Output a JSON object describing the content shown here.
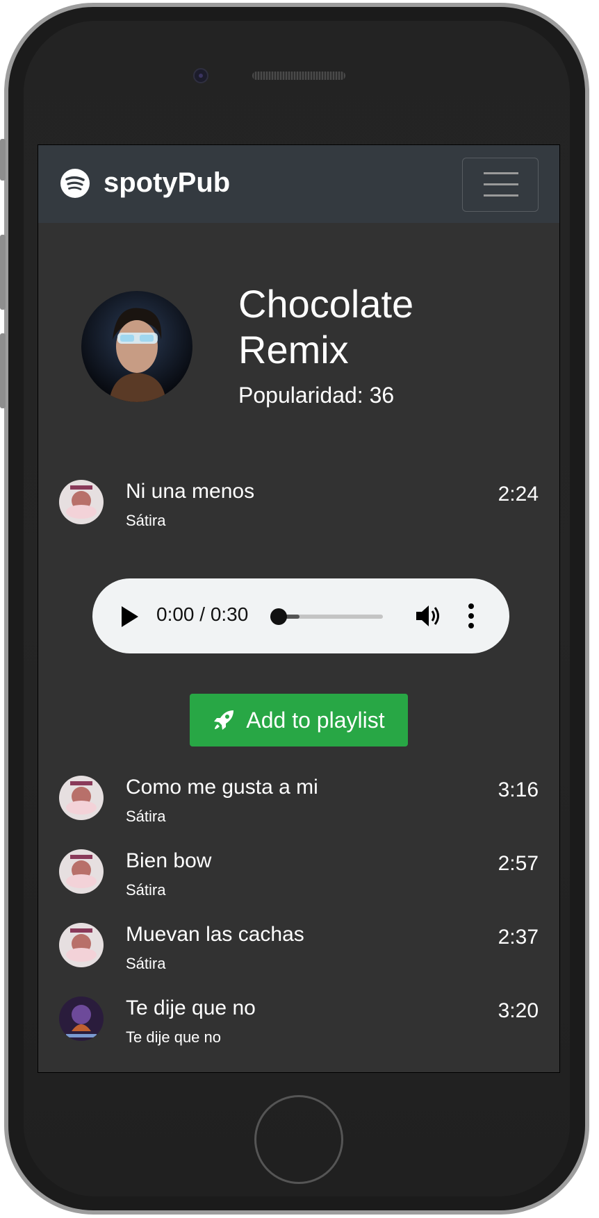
{
  "app": {
    "brand": "spotyPub"
  },
  "artist": {
    "name": "Chocolate Remix",
    "popularity_text": "Popularidad: 36"
  },
  "tracks": [
    {
      "title": "Ni una menos",
      "artist": "Sátira",
      "duration": "2:24"
    },
    {
      "title": "Como me gusta a mi",
      "artist": "Sátira",
      "duration": "3:16"
    },
    {
      "title": "Bien bow",
      "artist": "Sátira",
      "duration": "2:57"
    },
    {
      "title": "Muevan las cachas",
      "artist": "Sátira",
      "duration": "2:37"
    },
    {
      "title": "Te dije que no",
      "artist": "Te dije que no",
      "duration": "3:20"
    }
  ],
  "player": {
    "time": "0:00 / 0:30",
    "progress_fraction": 0.0
  },
  "actions": {
    "add_to_playlist": "Add to playlist"
  },
  "colors": {
    "navbar": "#343a40",
    "background": "#323232",
    "accent_green": "#28a745",
    "player_bg": "#f1f3f4"
  },
  "icons": [
    "spotify-icon",
    "menu-icon",
    "play-icon",
    "volume-icon",
    "more-vert-icon",
    "rocket-icon"
  ]
}
